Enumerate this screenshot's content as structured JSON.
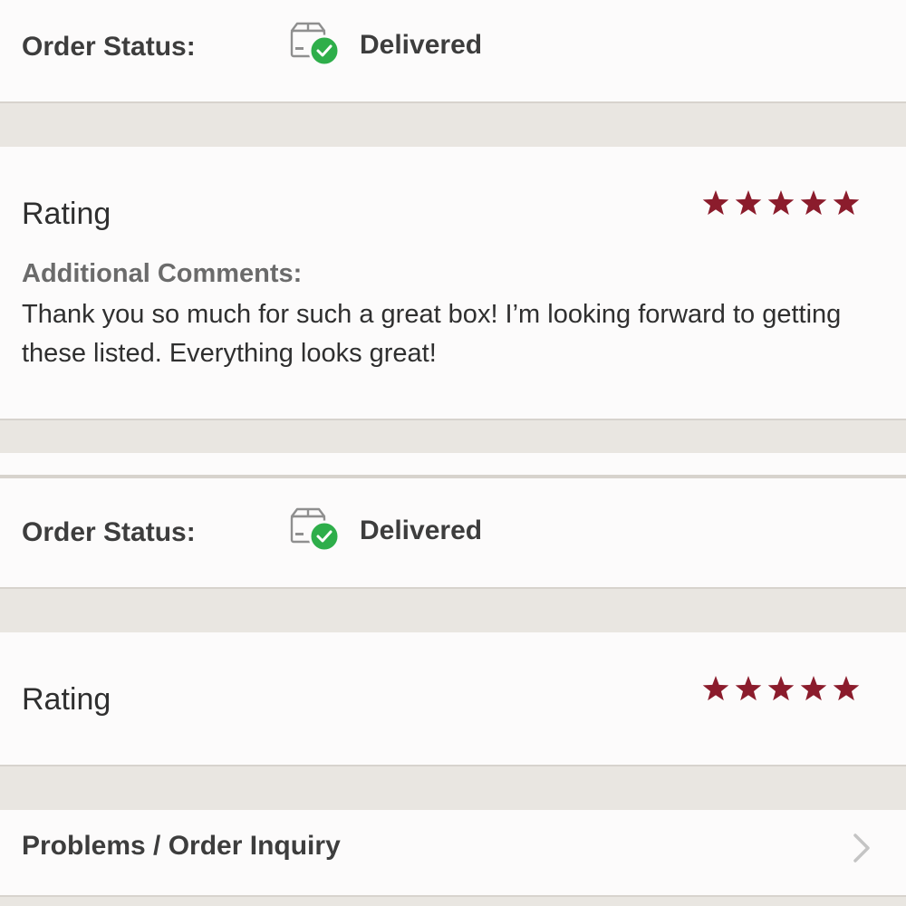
{
  "orders": [
    {
      "status_label": "Order Status:",
      "status_icon": "delivered-box-icon",
      "status_value": "Delivered",
      "rating_label": "Rating",
      "rating_stars": 5,
      "rating_max": 5,
      "comments_heading": "Additional Comments:",
      "comments_text": "Thank you so much for such a great box! I’m looking forward to getting these listed. Everything looks great!"
    },
    {
      "status_label": "Order Status:",
      "status_icon": "delivered-box-icon",
      "status_value": "Delivered",
      "rating_label": "Rating",
      "rating_stars": 5,
      "rating_max": 5
    }
  ],
  "inquiry": {
    "label": "Problems / Order Inquiry",
    "icon": "chevron-right-icon"
  },
  "colors": {
    "star": "#8b1c2c",
    "check": "#2eae4a",
    "background": "#e9e6e1",
    "card": "#fcfbfb"
  }
}
